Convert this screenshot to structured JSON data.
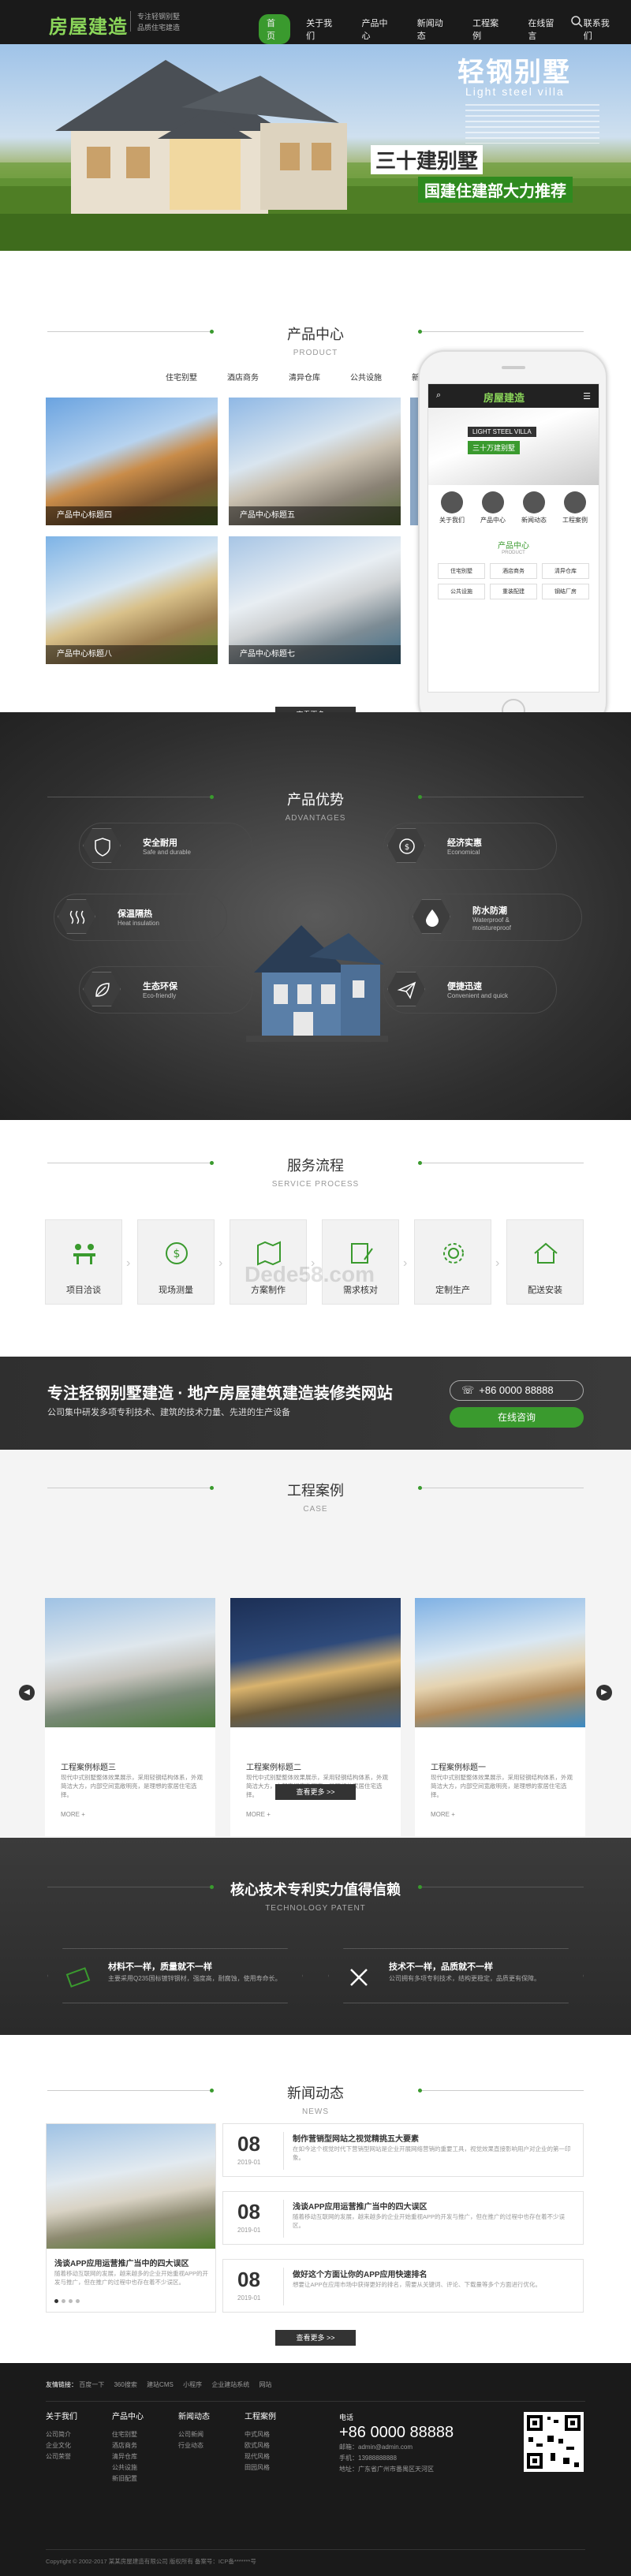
{
  "header": {
    "logo": "房屋建造",
    "tagline1": "专注轻钢别墅",
    "tagline2": "品质住宅建造",
    "nav": [
      "首页",
      "关于我们",
      "产品中心",
      "新闻动态",
      "工程案例",
      "在线留言",
      "联系我们"
    ]
  },
  "banner": {
    "title": "轻钢别墅",
    "subtitle": "Light steel villa",
    "line1": "三十建别墅",
    "line2": "国建住建部大力推荐"
  },
  "products": {
    "title": "产品中心",
    "en": "PRODUCT",
    "tabs": [
      "住宅别墅",
      "酒店商务",
      "清异仓库",
      "公共设施",
      "新旧配置"
    ],
    "items": [
      "产品中心标题四",
      "产品中心标题五",
      "产品中心标题八",
      "产品中心标题七"
    ],
    "more": "查看更多 >>"
  },
  "phone": {
    "logo": "房屋建造",
    "banner_title": "LIGHT STEEL VILLA",
    "banner_sub": "三十万建别墅",
    "icons": [
      "关于我们",
      "产品中心",
      "新闻动态",
      "工程案例"
    ],
    "section": "产品中心",
    "section_en": "PRODUCT",
    "grid": [
      "住宅别墅",
      "酒店商务",
      "清异仓库",
      "公共设施",
      "重装配建",
      "钢结厂房"
    ]
  },
  "advantages": {
    "title": "产品优势",
    "en": "ADVANTAGES",
    "items": [
      {
        "t": "安全耐用",
        "s": "Safe and durable"
      },
      {
        "t": "经济实惠",
        "s": "Economical"
      },
      {
        "t": "保温隔热",
        "s": "Heat insulation"
      },
      {
        "t": "防水防潮",
        "s": "Waterproof &"
      },
      {
        "t": "生态环保",
        "s": "Eco-friendly"
      },
      {
        "t": "便捷迅速",
        "s": "Convenient and quick"
      }
    ],
    "s4_line2": "moistureproof"
  },
  "process": {
    "title": "服务流程",
    "en": "SERVICE PROCESS",
    "steps": [
      "项目洽谈",
      "现场测量",
      "方案制作",
      "需求核对",
      "定制生产",
      "配送安装"
    ],
    "watermark": "Dede58.com"
  },
  "cta": {
    "heading": "专注轻钢别墅建造 · 地产房屋建筑建造装修类网站",
    "sub": "公司集中研发多项专利技术、建筑的技术力量、先进的生产设备",
    "phone": "+86 0000 88888",
    "button": "在线咨询"
  },
  "cases": {
    "title": "工程案例",
    "en": "CASE",
    "items": [
      {
        "t": "工程案例标题三",
        "d": "现代中式别墅整体效果展示，采用轻钢结构体系，外观简洁大方，内部空间宽敞明亮，是理想的家居住宅选择。",
        "m": "MORE +"
      },
      {
        "t": "工程案例标题二",
        "d": "现代中式别墅整体效果展示，采用轻钢结构体系，外观简洁大方，内部空间宽敞明亮，是理想的家居住宅选择。",
        "m": "MORE +"
      },
      {
        "t": "工程案例标题一",
        "d": "现代中式别墅整体效果展示，采用轻钢结构体系，外观简洁大方，内部空间宽敞明亮，是理想的家居住宅选择。",
        "m": "MORE +"
      }
    ],
    "more": "查看更多 >>"
  },
  "tech": {
    "title": "核心技术专利实力值得信赖",
    "en": "TECHNOLOGY PATENT",
    "items": [
      {
        "t": "材料不一样，质量就不一样",
        "d": "主要采用Q235国标镀锌钢材，强度高，耐腐蚀，使用寿命长。"
      },
      {
        "t": "技术不一样，品质就不一样",
        "d": "公司拥有多项专利技术，结构更稳定，品质更有保障。"
      }
    ]
  },
  "news": {
    "title": "新闻动态",
    "en": "NEWS",
    "feature": {
      "t": "浅谈APP应用运营推广当中的四大误区",
      "d": "随着移动互联网的发展，越来越多的企业开始重视APP的开发与推广，但在推广的过程中也存在着不少误区。"
    },
    "rows": [
      {
        "day": "08",
        "ym": "2019-01",
        "t": "制作营销型网站之视觉精挑五大要素",
        "d": "在如今这个视觉时代下营销型网站是企业开展网络营销的重要工具，视觉效果直接影响用户对企业的第一印象。"
      },
      {
        "day": "08",
        "ym": "2019-01",
        "t": "浅谈APP应用运营推广当中的四大误区",
        "d": "随着移动互联网的发展，越来越多的企业开始重视APP的开发与推广，但在推广的过程中也存在着不少误区。"
      },
      {
        "day": "08",
        "ym": "2019-01",
        "t": "做好这个方面让你的APP应用快速排名",
        "d": "想要让APP在应用市场中获得更好的排名，需要从关键词、评论、下载量等多个方面进行优化。"
      }
    ],
    "more": "查看更多 >>"
  },
  "footer": {
    "links_label": "友情链接：",
    "links": [
      "百度一下",
      "360搜索",
      "建站CMS",
      "小程序",
      "企业建站系统",
      "网站"
    ],
    "cols": [
      {
        "h": "关于我们",
        "i": [
          "公司简介",
          "企业文化",
          "公司荣誉"
        ]
      },
      {
        "h": "产品中心",
        "i": [
          "住宅别墅",
          "酒店商务",
          "清异仓库",
          "公共设施",
          "新旧配置"
        ]
      },
      {
        "h": "新闻动态",
        "i": [
          "公司新闻",
          "行业动态"
        ]
      },
      {
        "h": "工程案例",
        "i": [
          "中式风格",
          "欧式风格",
          "现代风格",
          "田园风格"
        ]
      }
    ],
    "contact_label": "电话",
    "phone": "+86 0000 88888",
    "email": "邮箱：admin@admin.com",
    "mobile": "手机：13988888888",
    "addr": "地址：广东省广州市番禺区天河区",
    "copyright": "Copyright © 2002-2017 某某房屋建造有限公司 版权所有    备案号：ICP备*******号"
  }
}
